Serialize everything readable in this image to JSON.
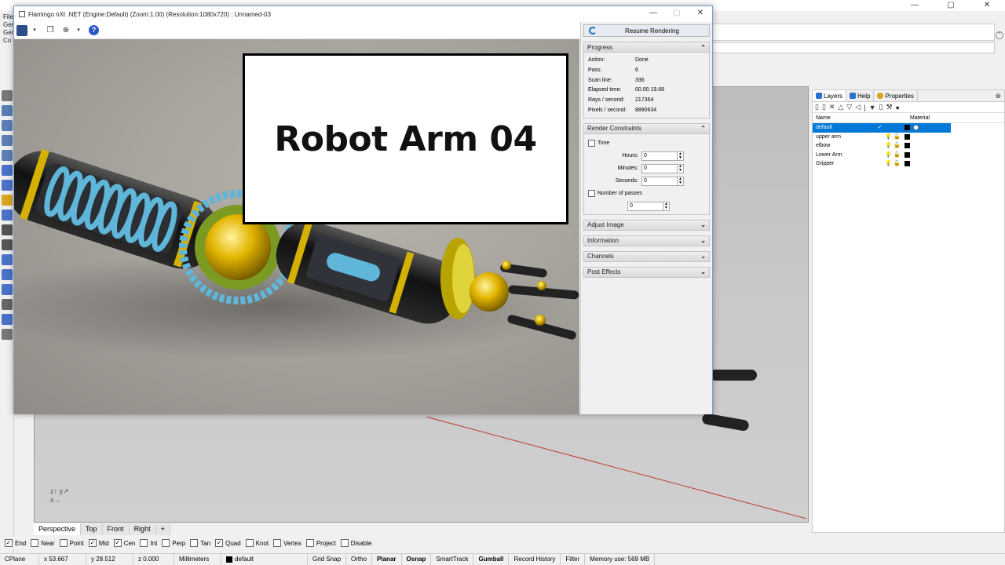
{
  "rhino": {
    "window_buttons": [
      "—",
      "▢",
      "✕"
    ],
    "left_labels": [
      "File",
      "Ger",
      "Ger",
      "Co"
    ],
    "viewport_tabs": [
      "Perspective",
      "Top",
      "Front",
      "Right",
      "+"
    ],
    "osnaps": [
      {
        "label": "End",
        "checked": true
      },
      {
        "label": "Near",
        "checked": false
      },
      {
        "label": "Point",
        "checked": false
      },
      {
        "label": "Mid",
        "checked": true
      },
      {
        "label": "Cen",
        "checked": true
      },
      {
        "label": "Int",
        "checked": false
      },
      {
        "label": "Perp",
        "checked": false
      },
      {
        "label": "Tan",
        "checked": false
      },
      {
        "label": "Quad",
        "checked": true
      },
      {
        "label": "Knot",
        "checked": false
      },
      {
        "label": "Vertex",
        "checked": false
      },
      {
        "label": "Project",
        "checked": false
      },
      {
        "label": "Disable",
        "checked": false
      }
    ],
    "status": {
      "cplane": "CPlane",
      "x": "x 53.667",
      "y": "y 28.512",
      "z": "z 0.000",
      "units": "Millimeters",
      "layer": "default",
      "grid_snap": "Grid Snap",
      "ortho": "Ortho",
      "planar": "Planar",
      "osnap": "Osnap",
      "smarttrack": "SmartTrack",
      "gumball": "Gumball",
      "record_history": "Record History",
      "filter": "Filter",
      "memory": "Memory use: 569 MB"
    }
  },
  "layers_panel": {
    "tabs": [
      "Layers",
      "Help",
      "Properties"
    ],
    "col_name": "Name",
    "col_material": "Material",
    "layers": [
      {
        "name": "default",
        "check": "✓",
        "selected": true
      },
      {
        "name": "upper arm",
        "check": "",
        "selected": false
      },
      {
        "name": "elbow",
        "check": "",
        "selected": false
      },
      {
        "name": "Lower Arm",
        "check": "",
        "selected": false
      },
      {
        "name": "Gripper",
        "check": "",
        "selected": false
      }
    ]
  },
  "flamingo": {
    "title": "Flamingo nXt .NET (Engine:Default) (Zoom:1.00) (Resolution:1080x720) : Unnamed-03",
    "overlay_title": "Robot Arm 04",
    "resume_label": "Resume Rendering",
    "progress": {
      "header": "Progress",
      "rows": [
        {
          "k": "Action:",
          "v": "Done"
        },
        {
          "k": "Pass:",
          "v": "6"
        },
        {
          "k": "Scan line:",
          "v": "336"
        },
        {
          "k": "Elapsed time:",
          "v": "00.00.19.68"
        },
        {
          "k": "Rays / second:",
          "v": "217364"
        },
        {
          "k": "Pixels / second:",
          "v": "8890634"
        }
      ]
    },
    "constraints": {
      "header": "Render Constraints",
      "time_label": "Time",
      "hours_label": "Hours:",
      "hours_value": "0",
      "minutes_label": "Minutes:",
      "minutes_value": "0",
      "seconds_label": "Seconds:",
      "seconds_value": "0",
      "passes_label": "Number of passes",
      "passes_value": "0"
    },
    "collapsed_sections": [
      "Adjust Image",
      "Information",
      "Channels",
      "Post Effects"
    ]
  }
}
